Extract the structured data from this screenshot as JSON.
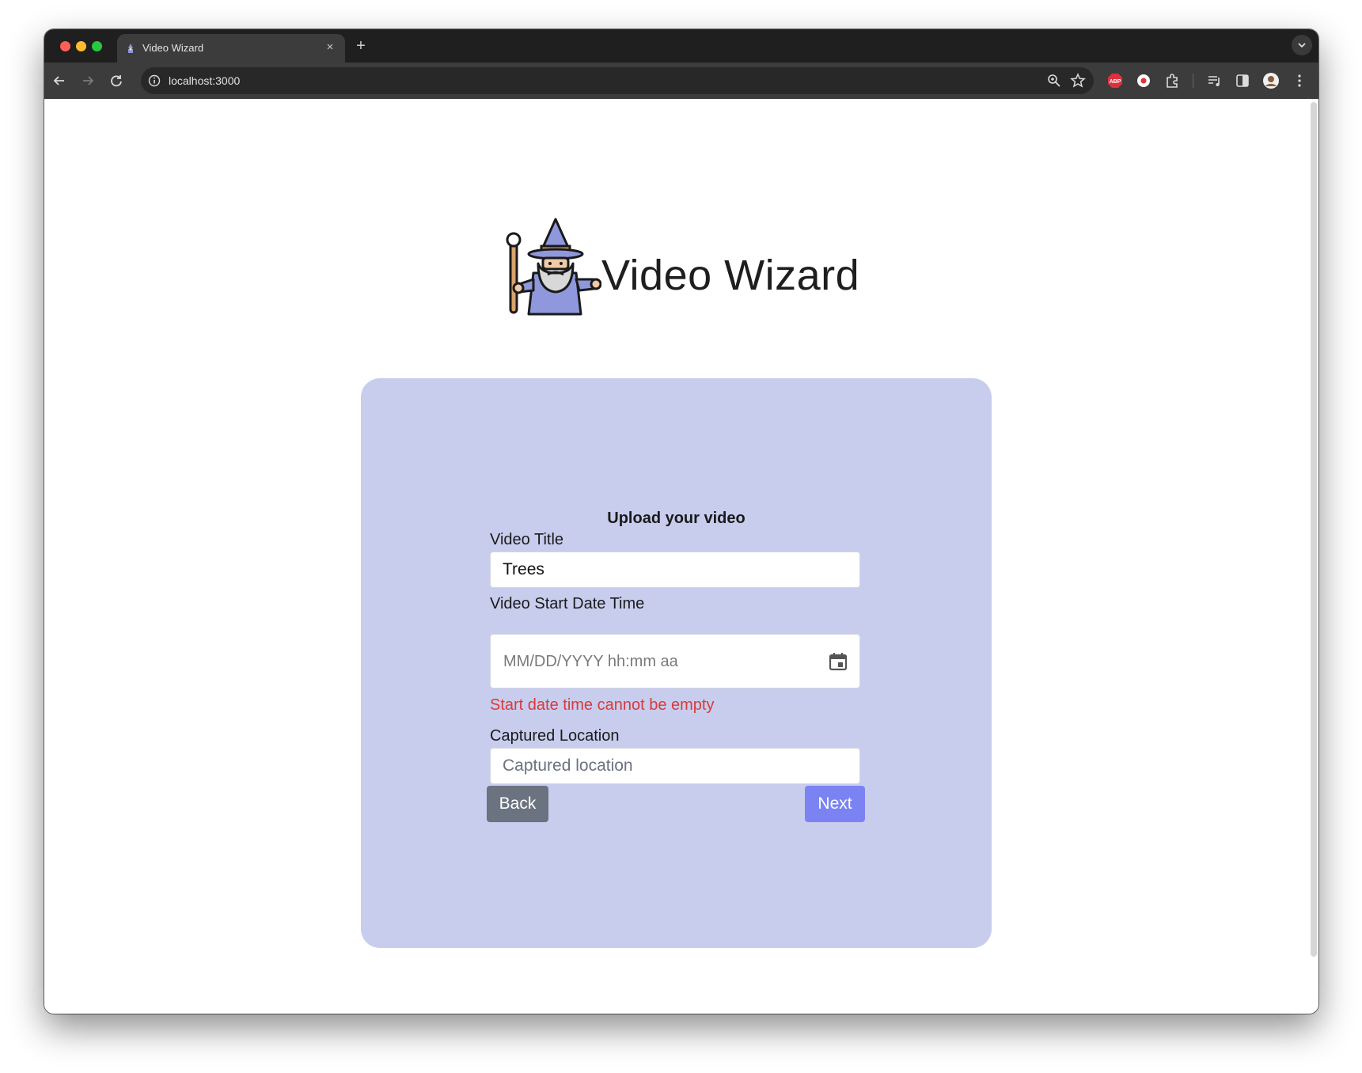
{
  "browser": {
    "tab_title": "Video Wizard",
    "tab_close": "×",
    "new_tab": "+",
    "url": "localhost:3000"
  },
  "page": {
    "brand_title": "Video Wizard"
  },
  "form": {
    "heading": "Upload your video",
    "title_label": "Video Title",
    "title_value": "Trees",
    "start_label": "Video Start Date Time",
    "start_placeholder": "MM/DD/YYYY hh:mm aa",
    "start_error": "Start date time cannot be empty",
    "location_label": "Captured Location",
    "location_placeholder": "Captured location",
    "back_label": "Back",
    "next_label": "Next"
  },
  "colors": {
    "card_bg": "#c8cdee",
    "error": "#d83a3a",
    "back_button": "#6b7280",
    "next_button": "#7b83f3"
  },
  "icons": [
    "wizard-logo",
    "calendar-icon",
    "back-arrow-icon",
    "forward-arrow-icon",
    "reload-icon",
    "site-info-icon",
    "zoom-icon",
    "bookmark-star-icon",
    "adblock-icon",
    "record-icon",
    "extensions-icon",
    "media-icon",
    "side-panel-icon",
    "profile-avatar",
    "menu-icon"
  ]
}
